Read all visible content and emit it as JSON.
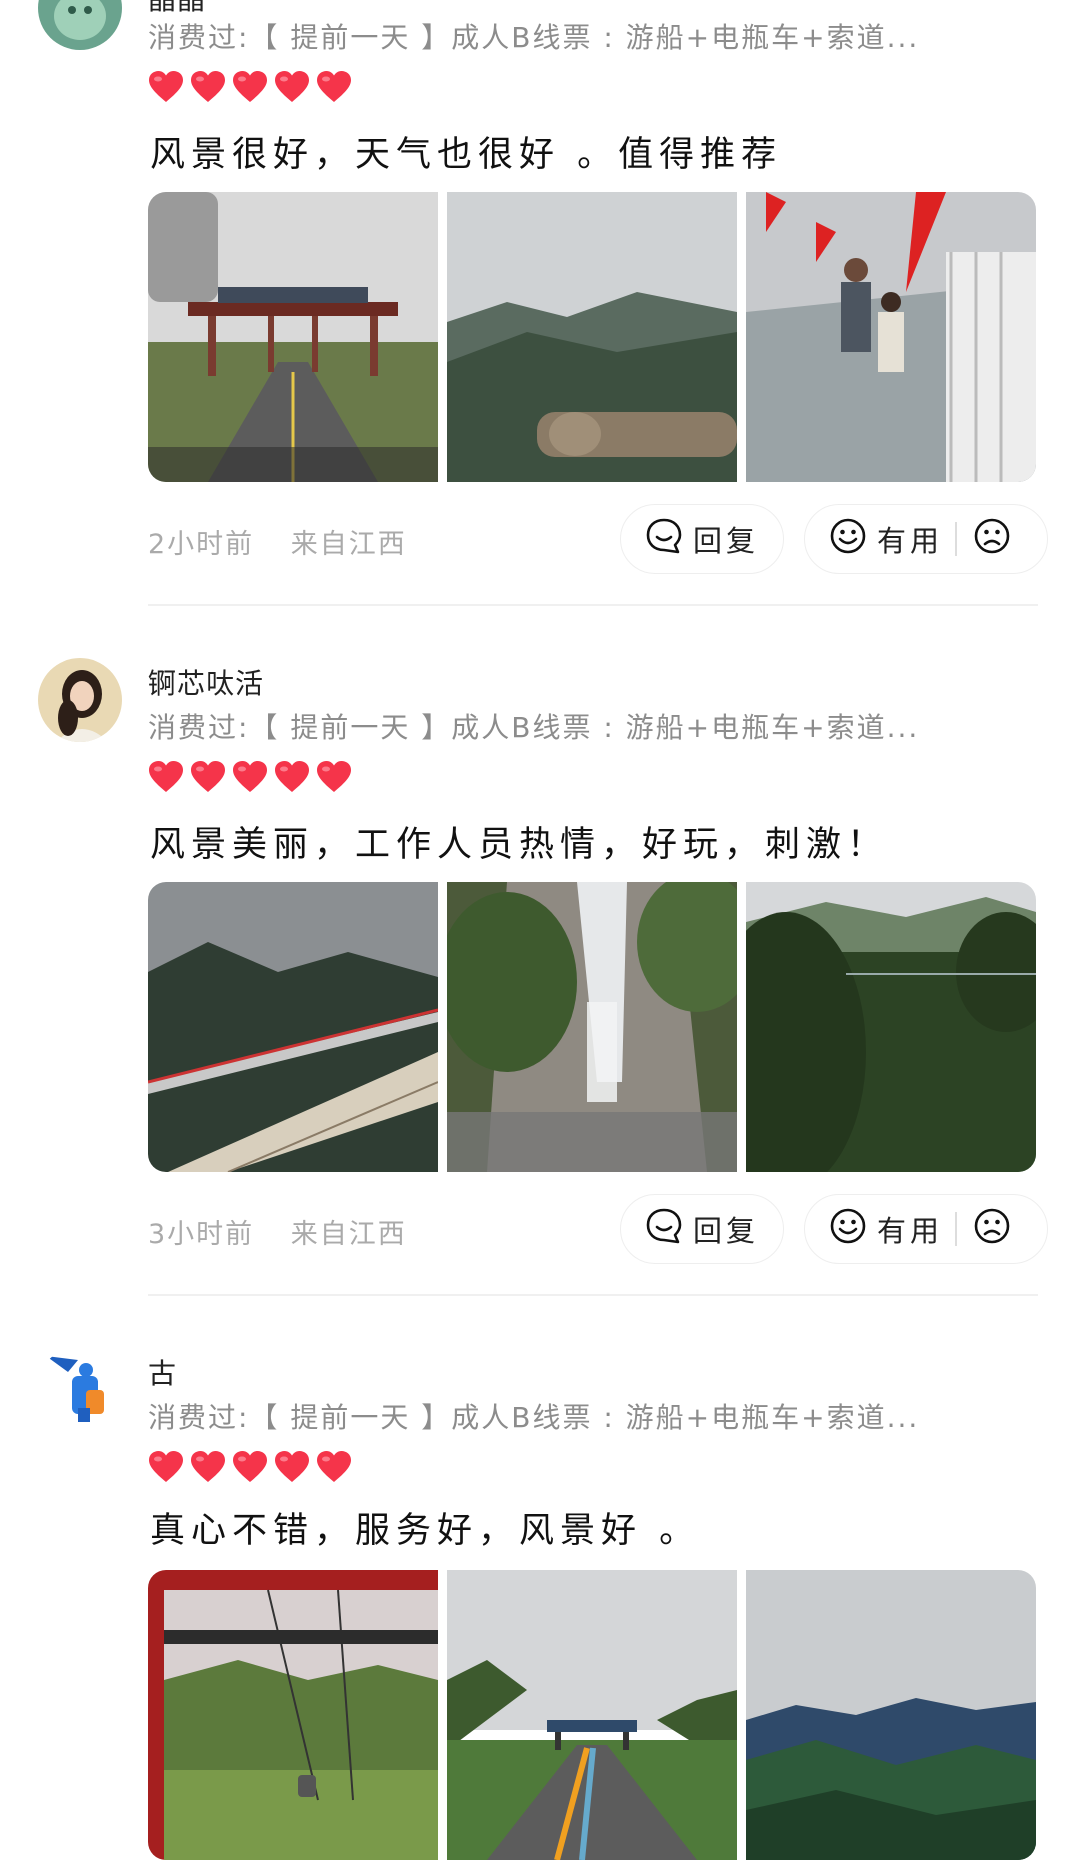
{
  "reviews": [
    {
      "username": "晶晶",
      "product": "消费过:【 提前一天 】成人B线票 : 游船+电瓶车+索道...",
      "rating": 5,
      "content": "风景很好，天气也很好 。值得推荐",
      "time": "2小时前",
      "location": "来自江西",
      "reply_label": "回复",
      "useful_label": "有用"
    },
    {
      "username": "锕芯呔活",
      "product": "消费过:【 提前一天 】成人B线票 : 游船+电瓶车+索道...",
      "rating": 5,
      "content": "风景美丽，工作人员热情，好玩，刺激！",
      "time": "3小时前",
      "location": "来自江西",
      "reply_label": "回复",
      "useful_label": "有用"
    },
    {
      "username": "古",
      "product": "消费过:【 提前一天 】成人B线票 : 游船+电瓶车+索道...",
      "rating": 5,
      "content": "真心不错，服务好，风景好 。",
      "reply_label": "回复",
      "useful_label": "有用"
    }
  ],
  "colors": {
    "heart": "#f5344a",
    "meta_text": "#aaaaaa",
    "product_text": "#8c8c8c"
  },
  "icons": {
    "reply": "chat-bubble-icon",
    "useful": "smiley-icon",
    "not_useful": "sad-face-icon",
    "rating": "heart-icon"
  }
}
